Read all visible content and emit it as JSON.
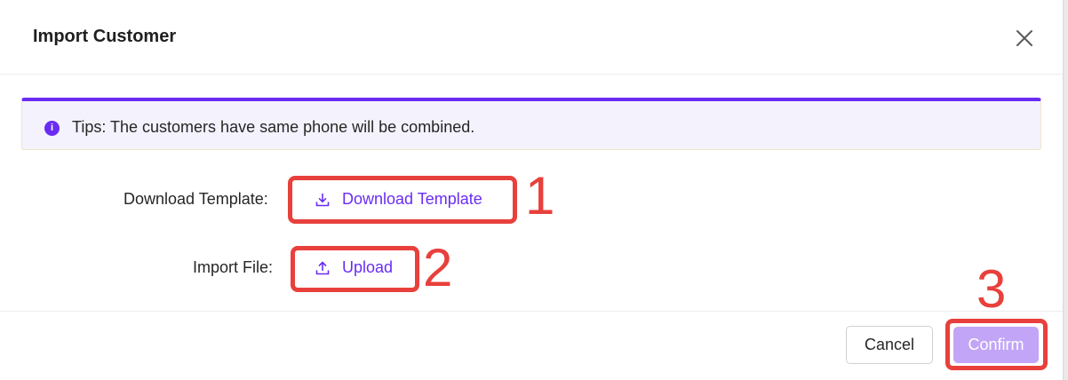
{
  "dialog": {
    "title": "Import Customer",
    "close_icon": "close-icon"
  },
  "tips": {
    "icon": "info-icon",
    "text": "Tips: The customers have same phone will be combined."
  },
  "form": {
    "download_label": "Download Template:",
    "download_button": "Download Template",
    "import_label": "Import File:",
    "upload_button": "Upload"
  },
  "annotations": [
    "1",
    "2",
    "3"
  ],
  "footer": {
    "cancel_label": "Cancel",
    "confirm_label": "Confirm"
  },
  "colors": {
    "accent": "#6a2cf3",
    "confirm_disabled": "#c2a5f6",
    "annotation": "#e8403c",
    "tips_bg": "#f4f2fd"
  }
}
